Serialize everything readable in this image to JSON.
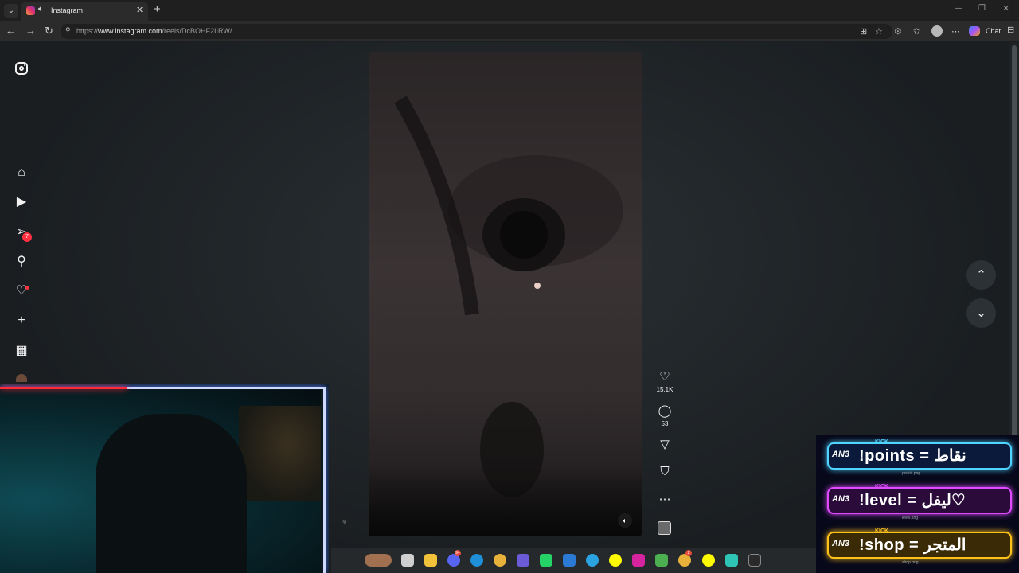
{
  "browser": {
    "tab_title": "Instagram",
    "tab_close": "✕",
    "new_tab": "+",
    "url_prefix": "https://",
    "url_domain": "www.instagram.com",
    "url_path": "/reels/DcBOHF2IIRW/",
    "chat_label": "Chat"
  },
  "sidebar": {
    "messages_badge": "7"
  },
  "reel": {
    "likes": "15.1K",
    "comments": "53"
  },
  "kick_commands": [
    {
      "text": "!points = نقاط",
      "file": "points.png",
      "kick": "KICK",
      "logo": "AN3",
      "color": "#4fd3ff"
    },
    {
      "text": "!level = ليفل♡",
      "file": "level.png",
      "kick": "KICK",
      "logo": "AN3",
      "color": "#e04bff"
    },
    {
      "text": "!shop = المتجر",
      "file": "shop.png",
      "kick": "KICK",
      "logo": "AN3",
      "color": "#ffc21a"
    }
  ],
  "icons": {
    "back": "←",
    "forward": "→",
    "reload": "↻",
    "up": "⌃",
    "down": "⌄"
  }
}
